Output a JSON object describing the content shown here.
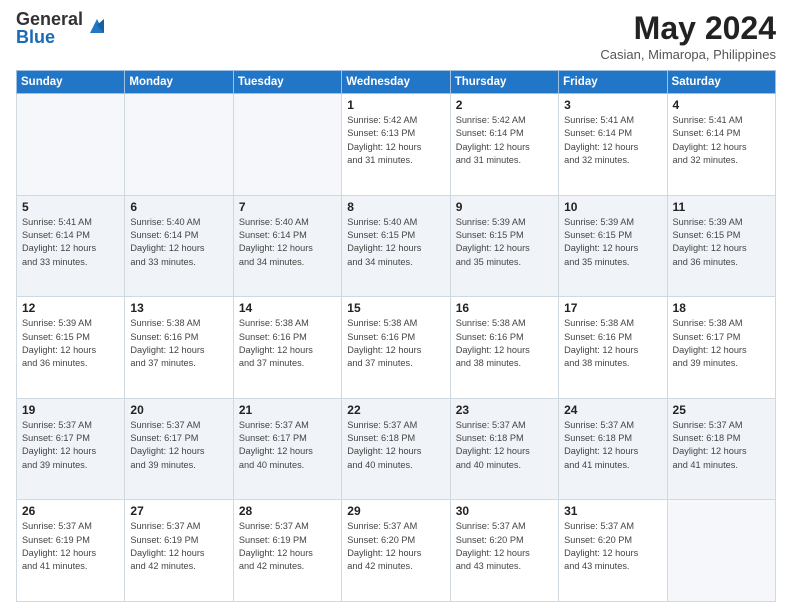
{
  "header": {
    "logo_general": "General",
    "logo_blue": "Blue",
    "month_year": "May 2024",
    "location": "Casian, Mimaropa, Philippines"
  },
  "weekdays": [
    "Sunday",
    "Monday",
    "Tuesday",
    "Wednesday",
    "Thursday",
    "Friday",
    "Saturday"
  ],
  "weeks": [
    [
      {
        "day": "",
        "info": ""
      },
      {
        "day": "",
        "info": ""
      },
      {
        "day": "",
        "info": ""
      },
      {
        "day": "1",
        "info": "Sunrise: 5:42 AM\nSunset: 6:13 PM\nDaylight: 12 hours\nand 31 minutes."
      },
      {
        "day": "2",
        "info": "Sunrise: 5:42 AM\nSunset: 6:14 PM\nDaylight: 12 hours\nand 31 minutes."
      },
      {
        "day": "3",
        "info": "Sunrise: 5:41 AM\nSunset: 6:14 PM\nDaylight: 12 hours\nand 32 minutes."
      },
      {
        "day": "4",
        "info": "Sunrise: 5:41 AM\nSunset: 6:14 PM\nDaylight: 12 hours\nand 32 minutes."
      }
    ],
    [
      {
        "day": "5",
        "info": "Sunrise: 5:41 AM\nSunset: 6:14 PM\nDaylight: 12 hours\nand 33 minutes."
      },
      {
        "day": "6",
        "info": "Sunrise: 5:40 AM\nSunset: 6:14 PM\nDaylight: 12 hours\nand 33 minutes."
      },
      {
        "day": "7",
        "info": "Sunrise: 5:40 AM\nSunset: 6:14 PM\nDaylight: 12 hours\nand 34 minutes."
      },
      {
        "day": "8",
        "info": "Sunrise: 5:40 AM\nSunset: 6:15 PM\nDaylight: 12 hours\nand 34 minutes."
      },
      {
        "day": "9",
        "info": "Sunrise: 5:39 AM\nSunset: 6:15 PM\nDaylight: 12 hours\nand 35 minutes."
      },
      {
        "day": "10",
        "info": "Sunrise: 5:39 AM\nSunset: 6:15 PM\nDaylight: 12 hours\nand 35 minutes."
      },
      {
        "day": "11",
        "info": "Sunrise: 5:39 AM\nSunset: 6:15 PM\nDaylight: 12 hours\nand 36 minutes."
      }
    ],
    [
      {
        "day": "12",
        "info": "Sunrise: 5:39 AM\nSunset: 6:15 PM\nDaylight: 12 hours\nand 36 minutes."
      },
      {
        "day": "13",
        "info": "Sunrise: 5:38 AM\nSunset: 6:16 PM\nDaylight: 12 hours\nand 37 minutes."
      },
      {
        "day": "14",
        "info": "Sunrise: 5:38 AM\nSunset: 6:16 PM\nDaylight: 12 hours\nand 37 minutes."
      },
      {
        "day": "15",
        "info": "Sunrise: 5:38 AM\nSunset: 6:16 PM\nDaylight: 12 hours\nand 37 minutes."
      },
      {
        "day": "16",
        "info": "Sunrise: 5:38 AM\nSunset: 6:16 PM\nDaylight: 12 hours\nand 38 minutes."
      },
      {
        "day": "17",
        "info": "Sunrise: 5:38 AM\nSunset: 6:16 PM\nDaylight: 12 hours\nand 38 minutes."
      },
      {
        "day": "18",
        "info": "Sunrise: 5:38 AM\nSunset: 6:17 PM\nDaylight: 12 hours\nand 39 minutes."
      }
    ],
    [
      {
        "day": "19",
        "info": "Sunrise: 5:37 AM\nSunset: 6:17 PM\nDaylight: 12 hours\nand 39 minutes."
      },
      {
        "day": "20",
        "info": "Sunrise: 5:37 AM\nSunset: 6:17 PM\nDaylight: 12 hours\nand 39 minutes."
      },
      {
        "day": "21",
        "info": "Sunrise: 5:37 AM\nSunset: 6:17 PM\nDaylight: 12 hours\nand 40 minutes."
      },
      {
        "day": "22",
        "info": "Sunrise: 5:37 AM\nSunset: 6:18 PM\nDaylight: 12 hours\nand 40 minutes."
      },
      {
        "day": "23",
        "info": "Sunrise: 5:37 AM\nSunset: 6:18 PM\nDaylight: 12 hours\nand 40 minutes."
      },
      {
        "day": "24",
        "info": "Sunrise: 5:37 AM\nSunset: 6:18 PM\nDaylight: 12 hours\nand 41 minutes."
      },
      {
        "day": "25",
        "info": "Sunrise: 5:37 AM\nSunset: 6:18 PM\nDaylight: 12 hours\nand 41 minutes."
      }
    ],
    [
      {
        "day": "26",
        "info": "Sunrise: 5:37 AM\nSunset: 6:19 PM\nDaylight: 12 hours\nand 41 minutes."
      },
      {
        "day": "27",
        "info": "Sunrise: 5:37 AM\nSunset: 6:19 PM\nDaylight: 12 hours\nand 42 minutes."
      },
      {
        "day": "28",
        "info": "Sunrise: 5:37 AM\nSunset: 6:19 PM\nDaylight: 12 hours\nand 42 minutes."
      },
      {
        "day": "29",
        "info": "Sunrise: 5:37 AM\nSunset: 6:20 PM\nDaylight: 12 hours\nand 42 minutes."
      },
      {
        "day": "30",
        "info": "Sunrise: 5:37 AM\nSunset: 6:20 PM\nDaylight: 12 hours\nand 43 minutes."
      },
      {
        "day": "31",
        "info": "Sunrise: 5:37 AM\nSunset: 6:20 PM\nDaylight: 12 hours\nand 43 minutes."
      },
      {
        "day": "",
        "info": ""
      }
    ]
  ]
}
